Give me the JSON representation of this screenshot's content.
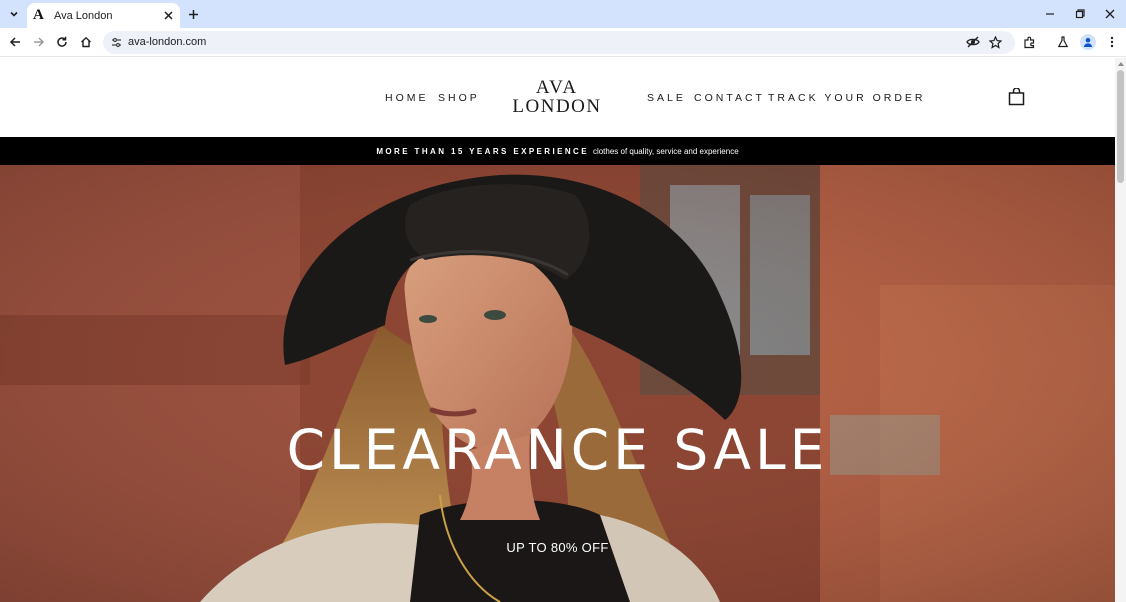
{
  "browser": {
    "tab": {
      "title": "Ava London",
      "favicon_letter": "A"
    },
    "omnibox": {
      "url": "ava-london.com"
    },
    "icons": {
      "tab_list": "chevron-down-icon",
      "tab_close": "close-icon",
      "new_tab": "plus-icon",
      "minimize": "minimize-icon",
      "restore": "restore-icon",
      "close_window": "close-icon",
      "back": "arrow-left-icon",
      "forward": "arrow-right-icon",
      "reload": "reload-icon",
      "home": "home-icon",
      "site_info": "tune-icon",
      "eye_off": "eye-off-icon",
      "bookmark": "star-icon",
      "extensions": "puzzle-icon",
      "labs": "flask-icon",
      "profile": "profile-icon",
      "menu": "kebab-menu-icon"
    },
    "colors": {
      "tabbar_bg": "#d3e3fd",
      "omnibox_bg": "#eef1f8"
    }
  },
  "site": {
    "nav_left": [
      "HOME",
      "SHOP"
    ],
    "logo": {
      "line1": "AVA",
      "line2": "LONDON"
    },
    "nav_right": [
      "SALE",
      "CONTACT",
      "TRACK YOUR ORDER"
    ],
    "cart_icon": "shopping-bag-icon",
    "announcement": {
      "strong": "MORE THAN 15 YEARS EXPERIENCE",
      "rest": "clothes of quality, service and experience"
    },
    "hero": {
      "title": "CLEARANCE SALE",
      "subtitle": "UP TO 80% OFF",
      "image": "woman-in-black-hat-photo"
    }
  }
}
